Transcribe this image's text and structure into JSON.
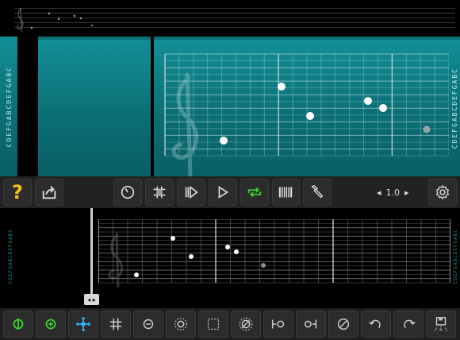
{
  "main_staff": {
    "note_labels": "CDEFGABCDEFGABC",
    "clef": "treble-clef-icon"
  },
  "bottom_staff": {
    "note_labels": "CDEFGABCDEFGABC",
    "clef": "treble-clef-icon"
  },
  "toolbar": {
    "help_label": "?",
    "zoom": {
      "left_arrow": "◂",
      "value": "1.0",
      "right_arrow": "▸"
    }
  },
  "scrubber": {
    "handle_label": "◂ ▸"
  },
  "colors": {
    "teal": "#0b7a80",
    "green": "#3ad12d",
    "blue": "#2fb4ff",
    "help_yellow": "#f2c21a"
  },
  "icons": {
    "main_toolbar": [
      "help-icon",
      "share-icon",
      "metronome-icon",
      "grid-icon",
      "play-from-start-icon",
      "play-icon",
      "loop-icon",
      "piano-icon",
      "wrench-icon",
      "zoom-control",
      "settings-icon"
    ],
    "bottom_toolbar": [
      "loop-select-icon",
      "add-note-icon",
      "move-icon",
      "snap-grid-icon",
      "remove-icon",
      "select-all-icon",
      "select-box-icon",
      "deselect-icon",
      "join-left-icon",
      "join-right-icon",
      "clear-icon",
      "undo-icon",
      "redo-icon",
      "save-icon"
    ]
  }
}
